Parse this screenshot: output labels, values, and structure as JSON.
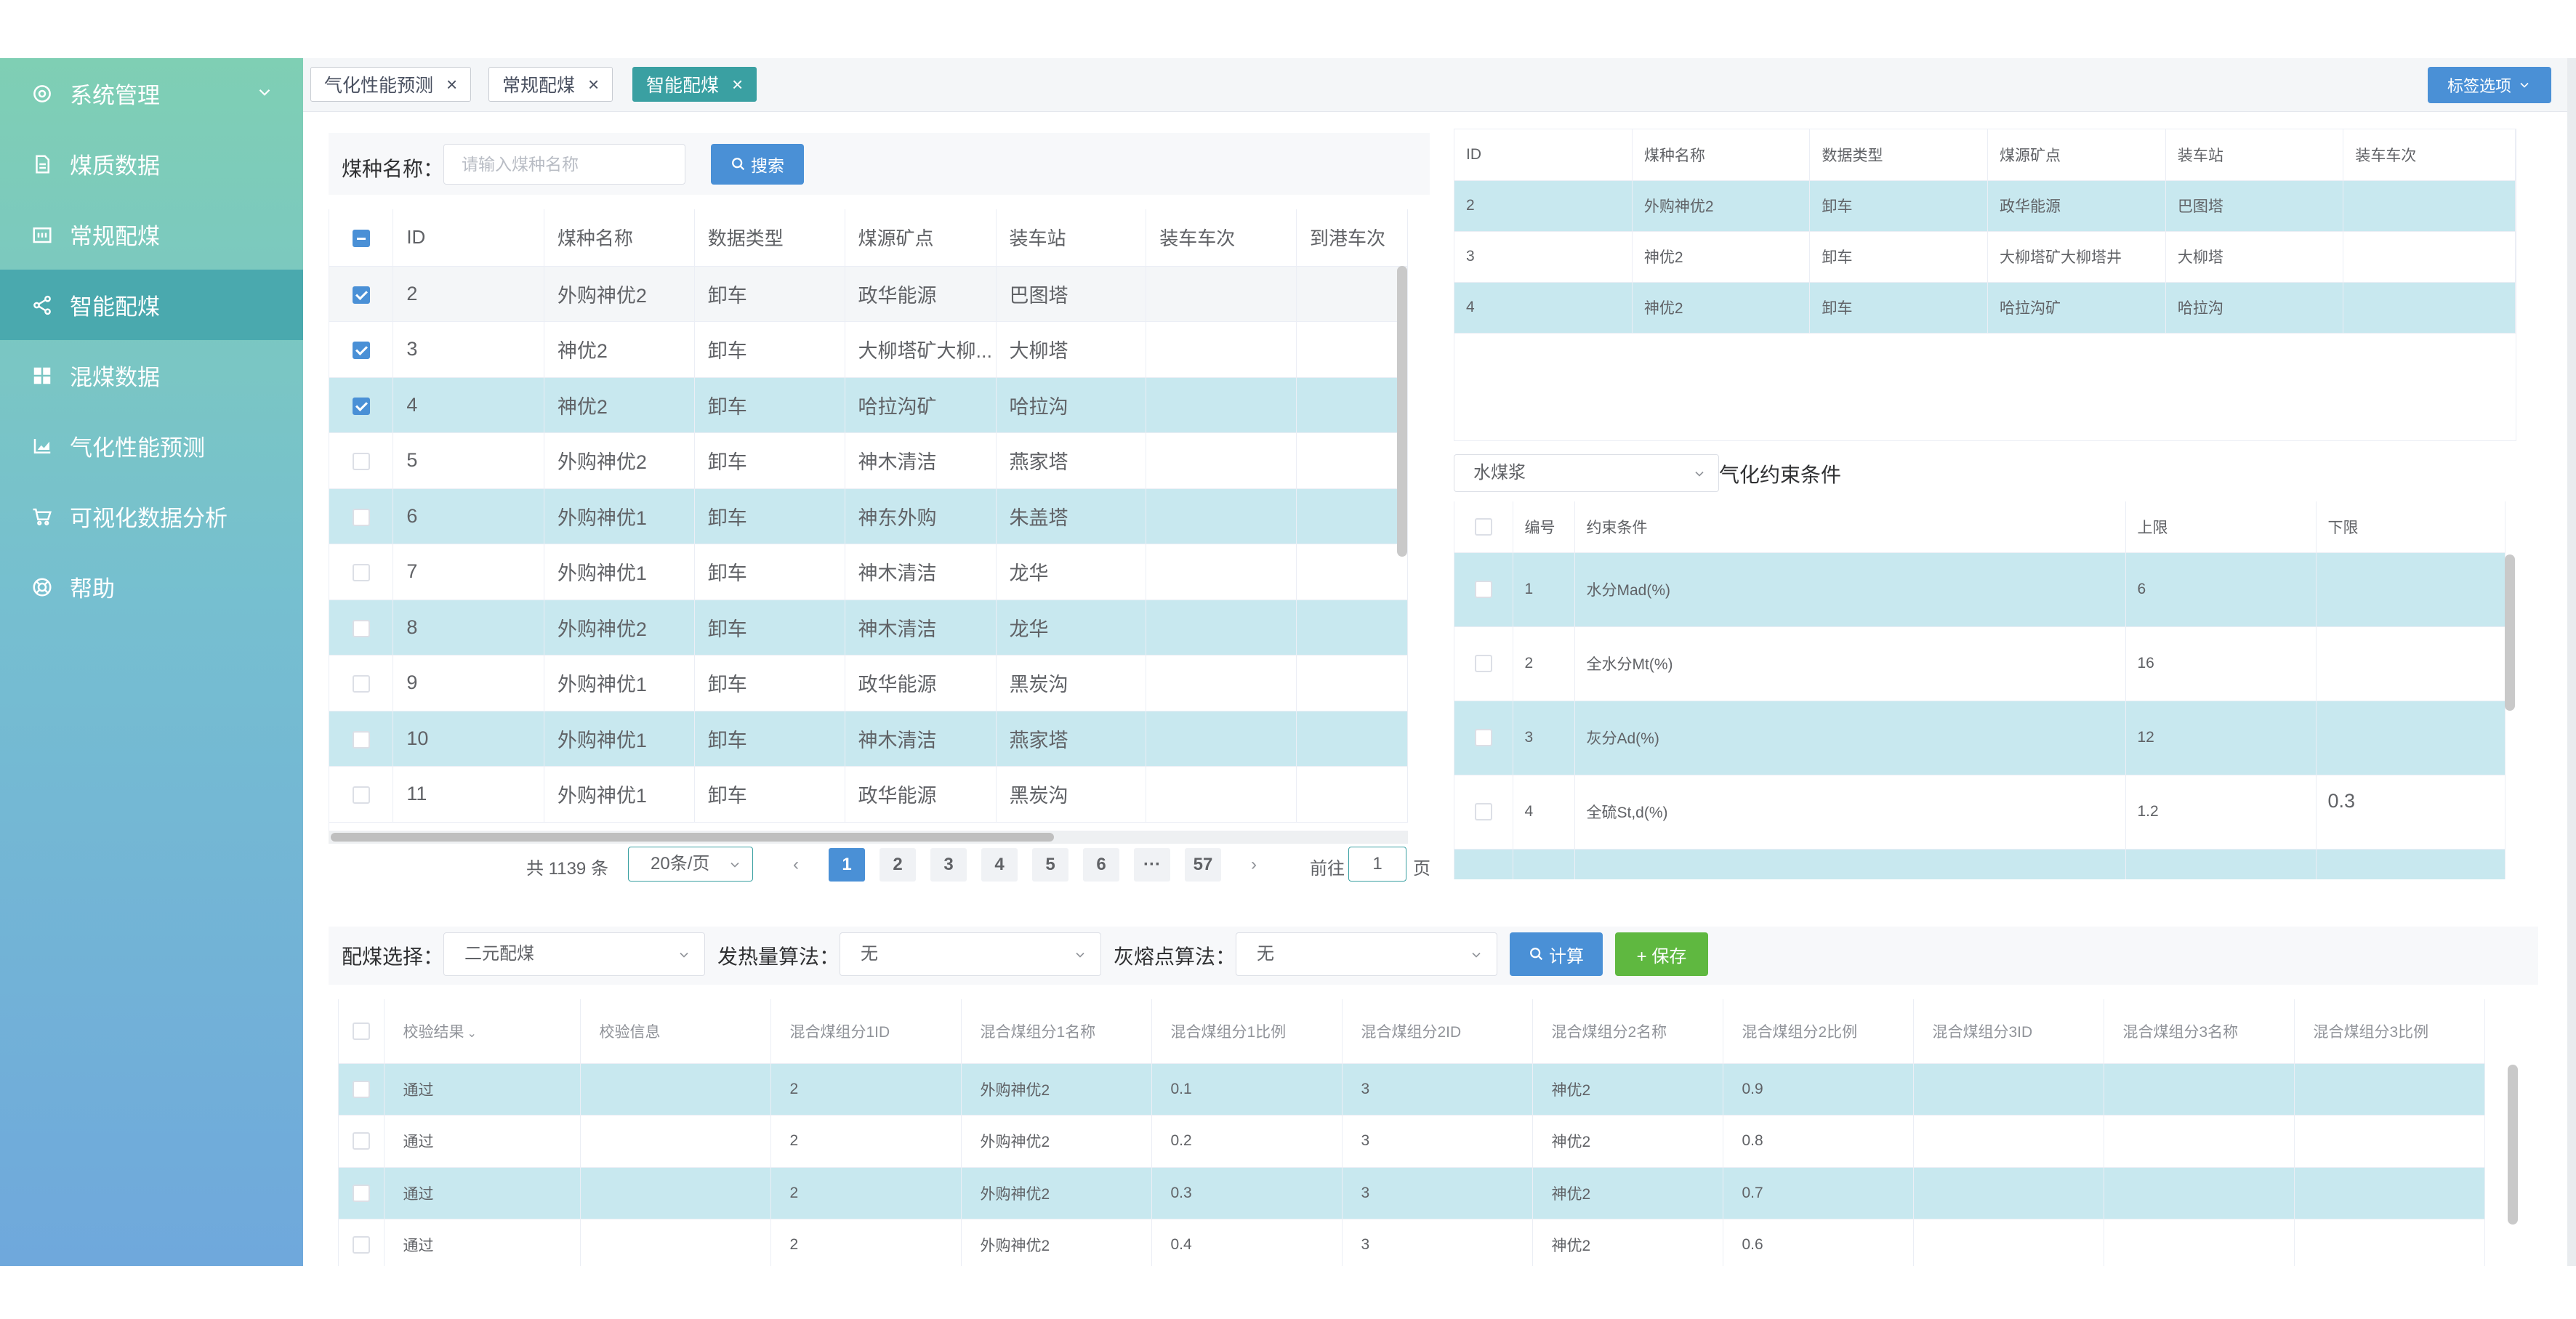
{
  "sidebar": {
    "items": [
      {
        "label": "系统管理",
        "icon": "gear-icon"
      },
      {
        "label": "煤质数据",
        "icon": "document-icon"
      },
      {
        "label": "常规配煤",
        "icon": "calendar-icon"
      },
      {
        "label": "智能配煤",
        "icon": "share-icon"
      },
      {
        "label": "混煤数据",
        "icon": "grid-icon"
      },
      {
        "label": "气化性能预测",
        "icon": "chart-icon"
      },
      {
        "label": "可视化数据分析",
        "icon": "cart-icon"
      },
      {
        "label": "帮助",
        "icon": "help-icon"
      }
    ]
  },
  "tabs": [
    {
      "label": "气化性能预测"
    },
    {
      "label": "常规配煤"
    },
    {
      "label": "智能配煤"
    }
  ],
  "tab_options_label": "标签选项",
  "coal_search": {
    "label": "煤种名称：",
    "placeholder": "请输入煤种名称",
    "button": "搜索"
  },
  "coal_table": {
    "columns": [
      "ID",
      "煤种名称",
      "数据类型",
      "煤源矿点",
      "装车站",
      "装车车次",
      "到港车次"
    ],
    "rows": [
      {
        "id": "2",
        "name": "外购神优2",
        "type": "卸车",
        "mine": "政华能源",
        "station": "巴图塔",
        "checked": true
      },
      {
        "id": "3",
        "name": "神优2",
        "type": "卸车",
        "mine": "大柳塔矿大柳...",
        "station": "大柳塔",
        "checked": true
      },
      {
        "id": "4",
        "name": "神优2",
        "type": "卸车",
        "mine": "哈拉沟矿",
        "station": "哈拉沟",
        "checked": true
      },
      {
        "id": "5",
        "name": "外购神优2",
        "type": "卸车",
        "mine": "神木清洁",
        "station": "燕家塔",
        "checked": false
      },
      {
        "id": "6",
        "name": "外购神优1",
        "type": "卸车",
        "mine": "神东外购",
        "station": "朱盖塔",
        "checked": false
      },
      {
        "id": "7",
        "name": "外购神优1",
        "type": "卸车",
        "mine": "神木清洁",
        "station": "龙华",
        "checked": false
      },
      {
        "id": "8",
        "name": "外购神优2",
        "type": "卸车",
        "mine": "神木清洁",
        "station": "龙华",
        "checked": false
      },
      {
        "id": "9",
        "name": "外购神优1",
        "type": "卸车",
        "mine": "政华能源",
        "station": "黑炭沟",
        "checked": false
      },
      {
        "id": "10",
        "name": "外购神优1",
        "type": "卸车",
        "mine": "神木清洁",
        "station": "燕家塔",
        "checked": false
      },
      {
        "id": "11",
        "name": "外购神优1",
        "type": "卸车",
        "mine": "政华能源",
        "station": "黑炭沟",
        "checked": false
      }
    ]
  },
  "pager": {
    "total": "共 1139 条",
    "size": "20条/页",
    "pages": [
      "1",
      "2",
      "3",
      "4",
      "5",
      "6",
      "···",
      "57"
    ],
    "prev": "‹",
    "next": "›",
    "goto_label": "前往",
    "goto_value": "1",
    "goto_suffix": "页"
  },
  "selected_table": {
    "columns": [
      "ID",
      "煤种名称",
      "数据类型",
      "煤源矿点",
      "装车站",
      "装车车次"
    ],
    "rows": [
      {
        "id": "2",
        "name": "外购神优2",
        "type": "卸车",
        "mine": "政华能源",
        "station": "巴图塔"
      },
      {
        "id": "3",
        "name": "神优2",
        "type": "卸车",
        "mine": "大柳塔矿大柳塔井",
        "station": "大柳塔"
      },
      {
        "id": "4",
        "name": "神优2",
        "type": "卸车",
        "mine": "哈拉沟矿",
        "station": "哈拉沟"
      }
    ]
  },
  "constraint": {
    "select_value": "水煤浆",
    "title": "气化约束条件",
    "columns": [
      "编号",
      "约束条件",
      "上限",
      "下限"
    ],
    "rows": [
      {
        "no": "1",
        "cond": "水分Mad(%)",
        "upper": "6",
        "lower": ""
      },
      {
        "no": "2",
        "cond": "全水分Mt(%)",
        "upper": "16",
        "lower": ""
      },
      {
        "no": "3",
        "cond": "灰分Ad(%)",
        "upper": "12",
        "lower": ""
      },
      {
        "no": "4",
        "cond": "全硫St,d(%)",
        "upper": "1.2",
        "lower": "0.3"
      }
    ]
  },
  "blend": {
    "blend_label": "配煤选择：",
    "blend_value": "二元配煤",
    "heat_label": "发热量算法：",
    "heat_value": "无",
    "ash_label": "灰熔点算法：",
    "ash_value": "无",
    "calc_label": "计算",
    "save_label": "+ 保存"
  },
  "result_table": {
    "columns": [
      "校验结果",
      "校验信息",
      "混合煤组分1ID",
      "混合煤组分1名称",
      "混合煤组分1比例",
      "混合煤组分2ID",
      "混合煤组分2名称",
      "混合煤组分2比例",
      "混合煤组分3ID",
      "混合煤组分3名称",
      "混合煤组分3比例"
    ],
    "sort_icon": "chevron-down-icon",
    "rows": [
      {
        "result": "通过",
        "c1id": "2",
        "c1name": "外购神优2",
        "c1ratio": "0.1",
        "c2id": "3",
        "c2name": "神优2",
        "c2ratio": "0.9"
      },
      {
        "result": "通过",
        "c1id": "2",
        "c1name": "外购神优2",
        "c1ratio": "0.2",
        "c2id": "3",
        "c2name": "神优2",
        "c2ratio": "0.8"
      },
      {
        "result": "通过",
        "c1id": "2",
        "c1name": "外购神优2",
        "c1ratio": "0.3",
        "c2id": "3",
        "c2name": "神优2",
        "c2ratio": "0.7"
      },
      {
        "result": "通过",
        "c1id": "2",
        "c1name": "外购神优2",
        "c1ratio": "0.4",
        "c2id": "3",
        "c2name": "神优2",
        "c2ratio": "0.6"
      }
    ]
  },
  "colors": {
    "accent": "#4a90d6",
    "teal": "#3aa0a2",
    "row_highlight": "#c8e8ef",
    "save_green": "#5fb840"
  }
}
